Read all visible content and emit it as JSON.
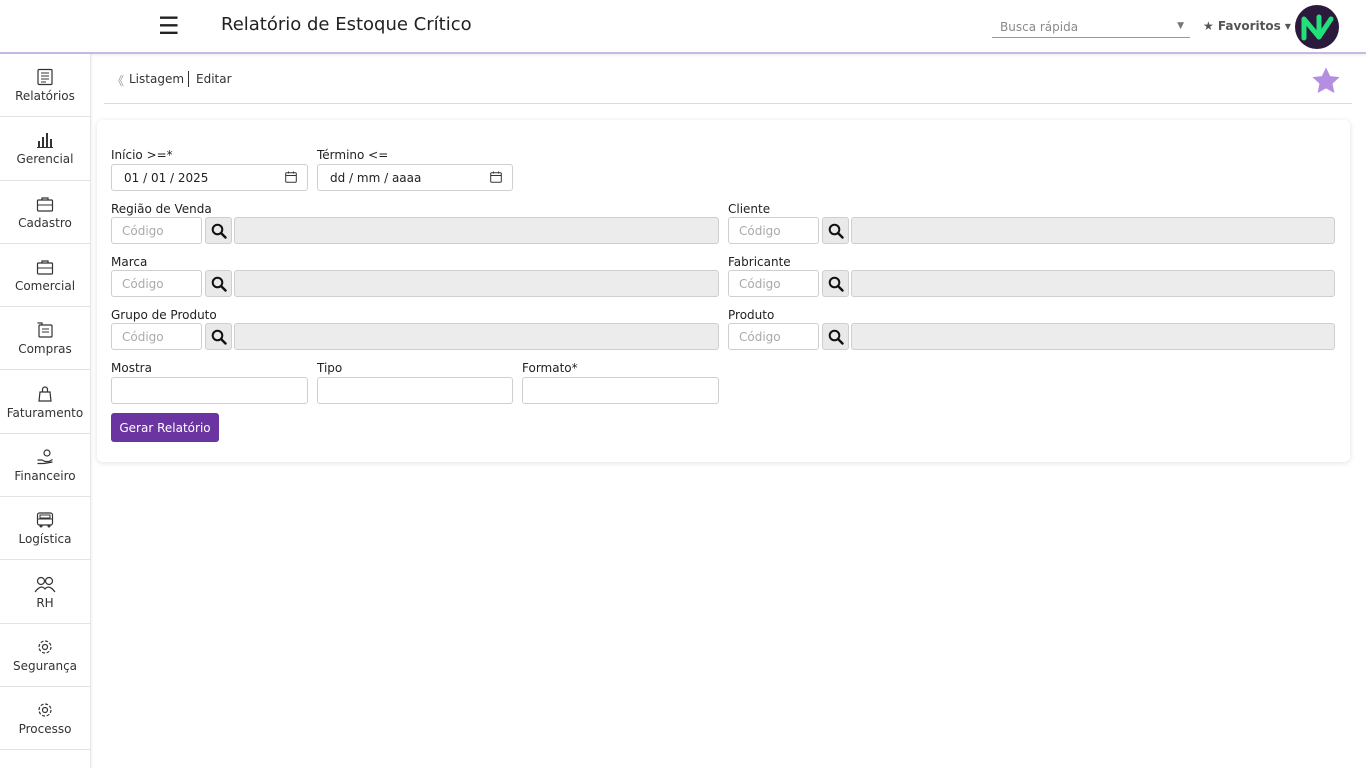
{
  "header": {
    "menu_icon": "☰",
    "title": "Relatório de Estoque Crítico",
    "quick_search_placeholder": "Busca rápida",
    "favorites_label": "★ Favoritos ▾"
  },
  "sidebar": {
    "items": [
      {
        "label": "Relatórios",
        "icon": "report-icon"
      },
      {
        "label": "Gerencial",
        "icon": "chart-bars-icon"
      },
      {
        "label": "Cadastro",
        "icon": "briefcase-icon"
      },
      {
        "label": "Comercial",
        "icon": "briefcase-icon"
      },
      {
        "label": "Compras",
        "icon": "purchases-icon"
      },
      {
        "label": "Faturamento",
        "icon": "bag-icon"
      },
      {
        "label": "Financeiro",
        "icon": "money-hand-icon"
      },
      {
        "label": "Logística",
        "icon": "truck-icon"
      },
      {
        "label": "RH",
        "icon": "people-icon"
      },
      {
        "label": "Segurança",
        "icon": "gear-icon"
      },
      {
        "label": "Processo",
        "icon": "gear-icon"
      }
    ]
  },
  "breadcrumb": {
    "back_icon": "《",
    "list_label": "Listagem",
    "edit_label": "Editar"
  },
  "form": {
    "inicio": {
      "label": "Início >=*",
      "value": "01 / 01 / 2025"
    },
    "termino": {
      "label": "Término <=",
      "value": "dd / mm / aaaa"
    },
    "regiao_venda": {
      "label": "Região de Venda",
      "placeholder": "Código"
    },
    "cliente": {
      "label": "Cliente",
      "placeholder": "Código"
    },
    "marca": {
      "label": "Marca",
      "placeholder": "Código"
    },
    "fabricante": {
      "label": "Fabricante",
      "placeholder": "Código"
    },
    "grupo_produto": {
      "label": "Grupo de Produto",
      "placeholder": "Código"
    },
    "produto": {
      "label": "Produto",
      "placeholder": "Código"
    },
    "mostra": {
      "label": "Mostra",
      "value": ""
    },
    "tipo": {
      "label": "Tipo",
      "value": ""
    },
    "formato": {
      "label": "Formato*",
      "value": ""
    },
    "submit_label": "Gerar Relatório"
  },
  "colors": {
    "accent": "#6a35a0",
    "star": "#b48fe0",
    "logo_bg": "#2c1a3d",
    "logo_mark": "#22e07a"
  }
}
